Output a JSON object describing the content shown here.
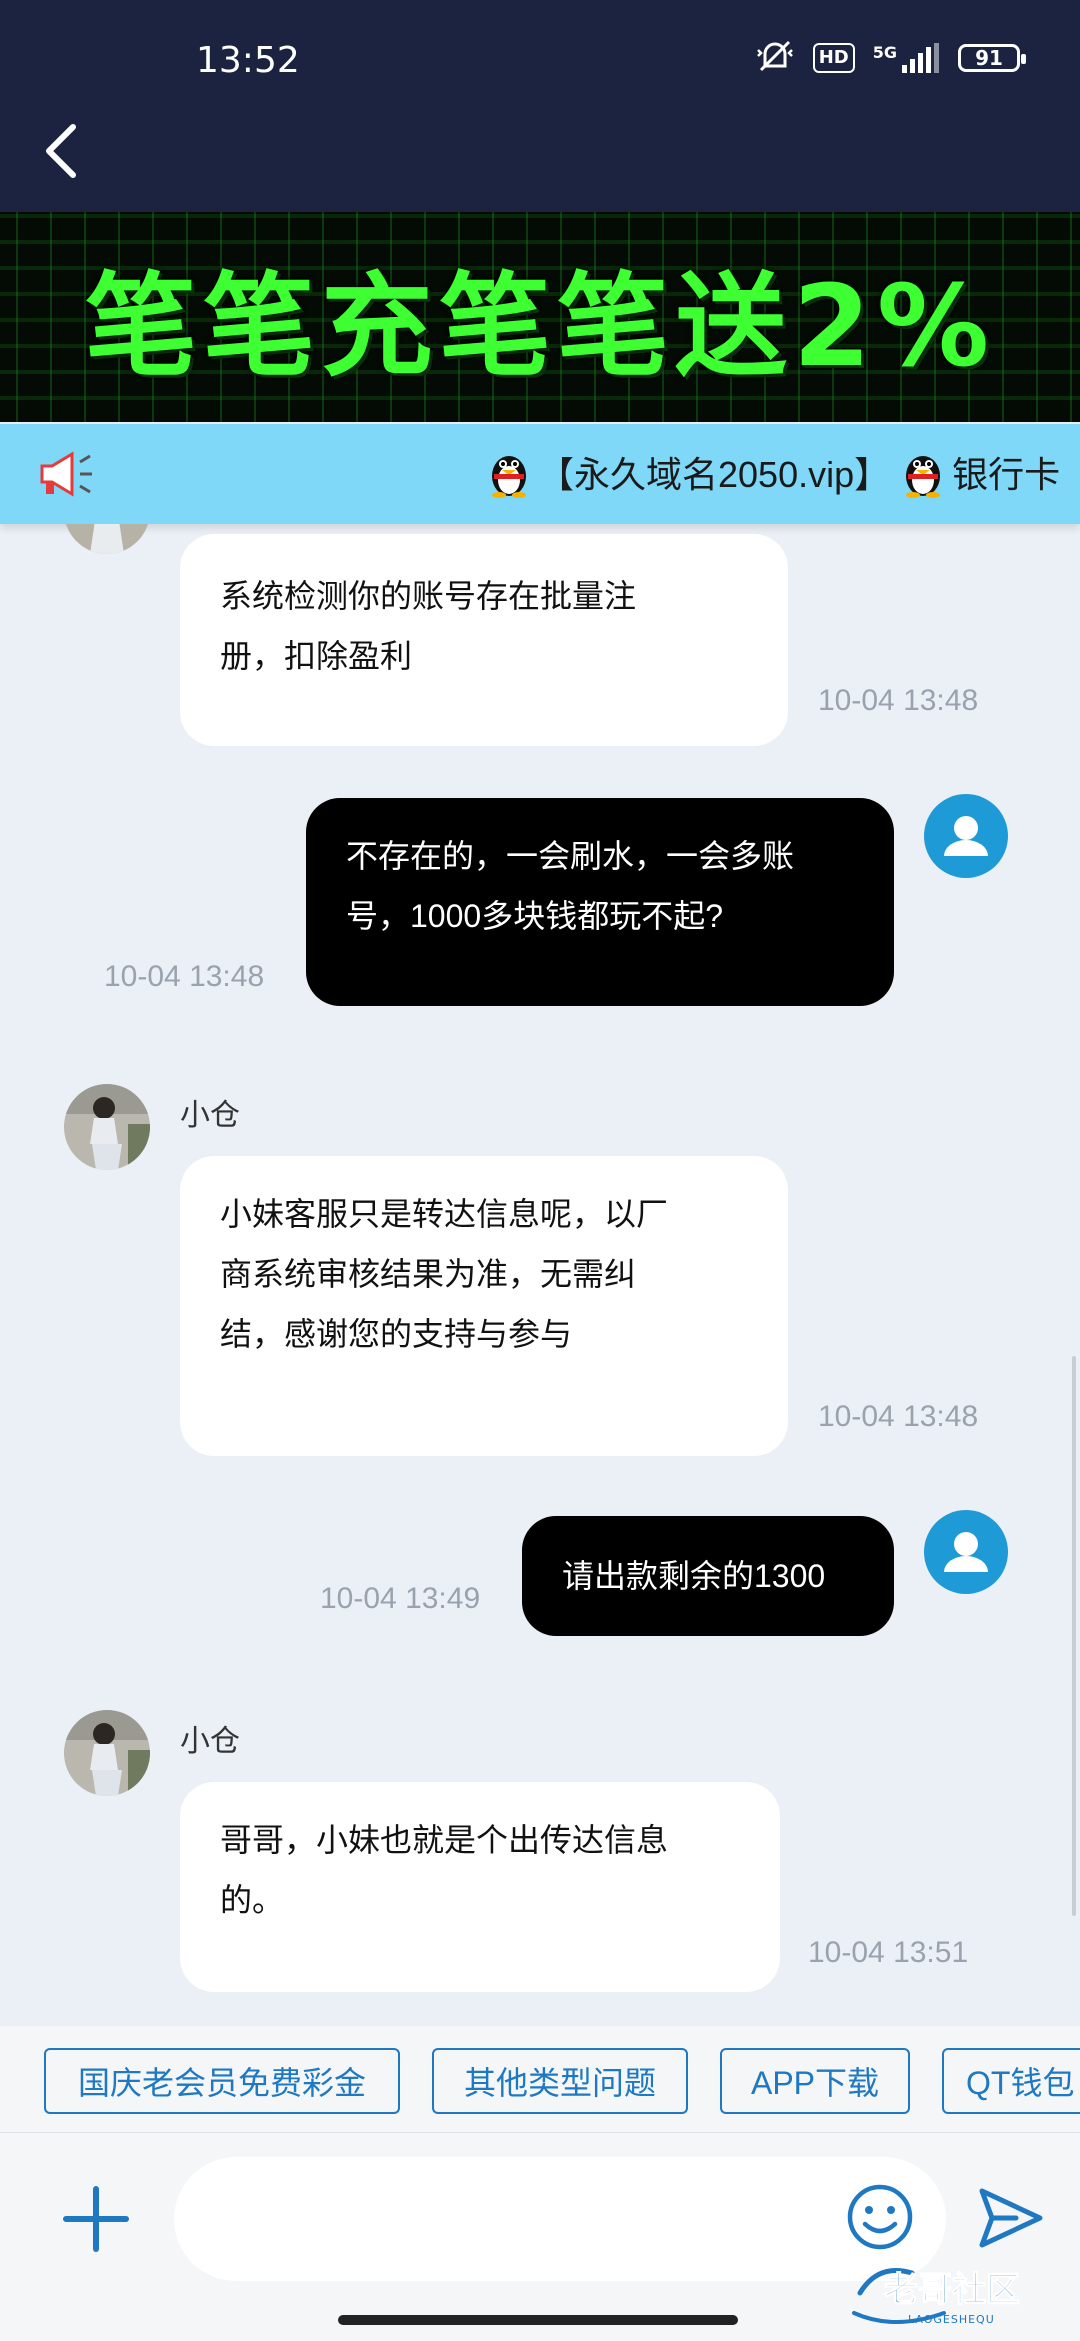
{
  "status_bar": {
    "time": "13:52",
    "network": "5G",
    "hd": "HD",
    "battery": "91"
  },
  "banner": {
    "text": "笔笔充笔笔送2%"
  },
  "notice": {
    "text": "【永久域名2050.vip】",
    "text_after": "银行卡"
  },
  "messages": [
    {
      "side": "in",
      "lines": [
        "系统检测你的账号存在批量注",
        "册，扣除盈利"
      ],
      "time": "10-04 13:48"
    },
    {
      "side": "out",
      "lines": [
        "不存在的，一会刷水，一会多账",
        "号，1000多块钱都玩不起?"
      ],
      "time": "10-04 13:48"
    },
    {
      "side": "in",
      "sender": "小仓",
      "lines": [
        "小妹客服只是转达信息呢，以厂",
        "商系统审核结果为准，无需纠",
        "结，感谢您的支持与参与"
      ],
      "time": "10-04 13:48"
    },
    {
      "side": "out",
      "lines": [
        "请出款剩余的1300"
      ],
      "time": "10-04 13:49"
    },
    {
      "side": "in",
      "sender": "小仓",
      "lines": [
        "哥哥，小妹也就是个出传达信息",
        "的。"
      ],
      "time": "10-04 13:51"
    }
  ],
  "quick_replies": [
    "国庆老会员免费彩金",
    "其他类型问题",
    "APP下载",
    "QT钱包"
  ],
  "input": {
    "placeholder": ""
  },
  "watermark": {
    "text": "老哥社区",
    "subtext": "LAOGESHEQU"
  },
  "colors": {
    "header_bg": "#1b2340",
    "notice_bg": "#7fd8f7",
    "accent": "#1f78c2",
    "avatar_me": "#1e9ad6",
    "banner_text": "#3dff32"
  }
}
